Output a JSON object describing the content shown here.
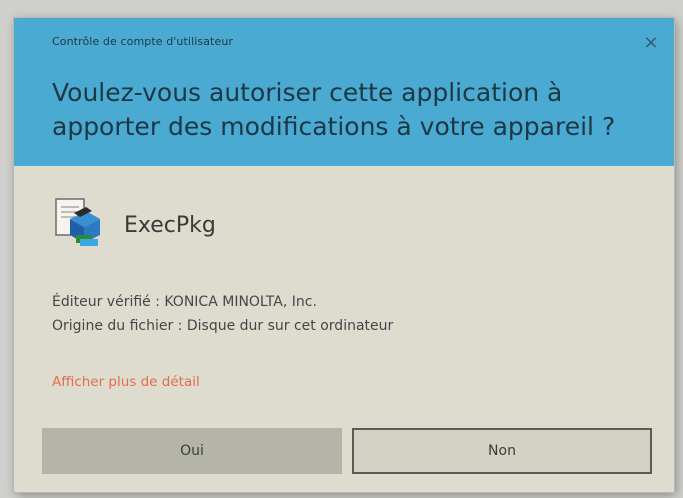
{
  "dialog": {
    "uac_title": "Contrôle de compte d'utilisateur",
    "question": "Voulez-vous autoriser cette application à apporter des modifications à votre appareil ?",
    "close_glyph": "×",
    "app_name": "ExecPkg",
    "publisher_line": "Éditeur vérifié : KONICA MINOLTA, Inc.",
    "origin_line": "Origine du fichier : Disque dur sur cet ordinateur",
    "details_link": "Afficher plus de détail",
    "yes_label": "Oui",
    "no_label": "Non"
  },
  "icons": {
    "app": "installer-package-icon",
    "close": "close-icon"
  },
  "colors": {
    "header": "#4aaad2",
    "body": "#dedbcf",
    "link": "#e46e49",
    "yes_button": "#b5b4a8",
    "no_button_border": "#5c5b55"
  }
}
